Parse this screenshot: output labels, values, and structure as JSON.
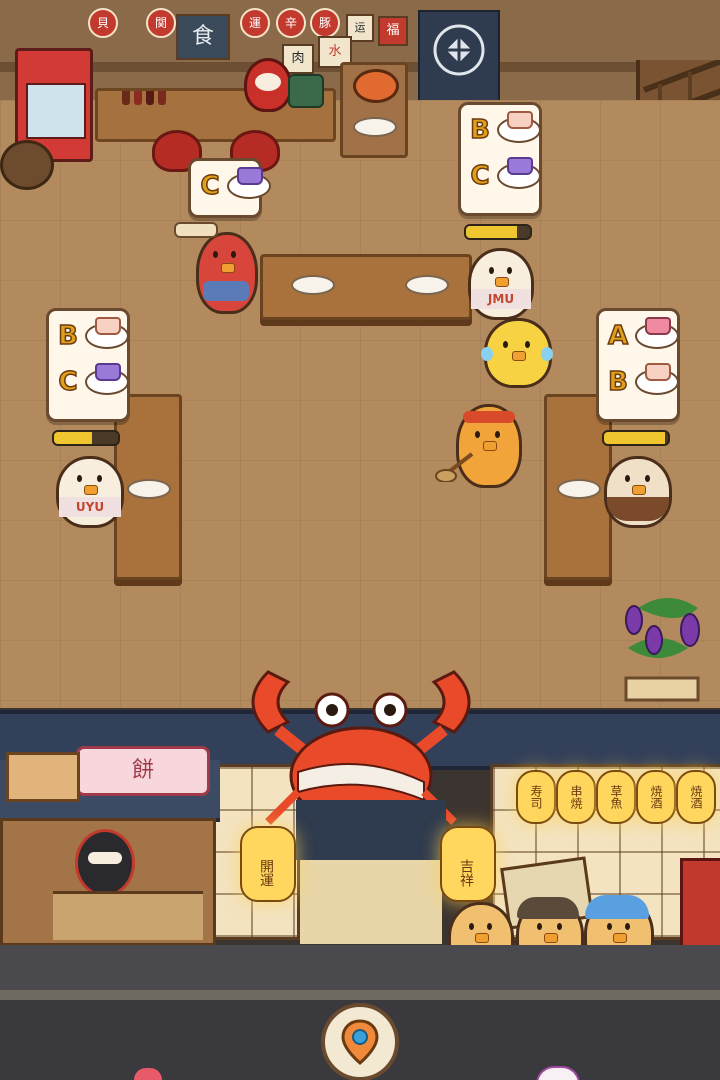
{
  "scene": {
    "back_wall_signs": [
      "貝",
      "関",
      "食",
      "運",
      "辛",
      "豚",
      "肉",
      "运",
      "水",
      "福"
    ],
    "shop_sign": "餅",
    "door_lanterns": [
      "開運",
      "吉祥"
    ],
    "right_lanterns": [
      "寿司",
      "串焼",
      "草魚",
      "焼酒",
      "焼酒"
    ],
    "apron_labels": [
      "JMU",
      "UYU"
    ]
  },
  "orders": [
    {
      "id": "order-counter",
      "items": [
        {
          "letter": "C",
          "dish": "purple-soup"
        }
      ],
      "patience": null
    },
    {
      "id": "order-top-right",
      "items": [
        {
          "letter": "B",
          "dish": "cake"
        },
        {
          "letter": "C",
          "dish": "purple-soup"
        }
      ],
      "patience": 0.8
    },
    {
      "id": "order-left",
      "items": [
        {
          "letter": "B",
          "dish": "cake"
        },
        {
          "letter": "C",
          "dish": "purple-soup"
        }
      ],
      "patience": 0.6
    },
    {
      "id": "order-right",
      "items": [
        {
          "letter": "A",
          "dish": "skewers"
        },
        {
          "letter": "B",
          "dish": "cake"
        }
      ],
      "patience": 0.95
    }
  ],
  "colors": {
    "floor": "#b38a5e",
    "accent_red": "#c23a2e",
    "lantern": "#ffd65e",
    "patience_fill": "#f0c630"
  },
  "icons": {
    "locate": "location-pin-icon",
    "mascot": "crab-icon"
  }
}
